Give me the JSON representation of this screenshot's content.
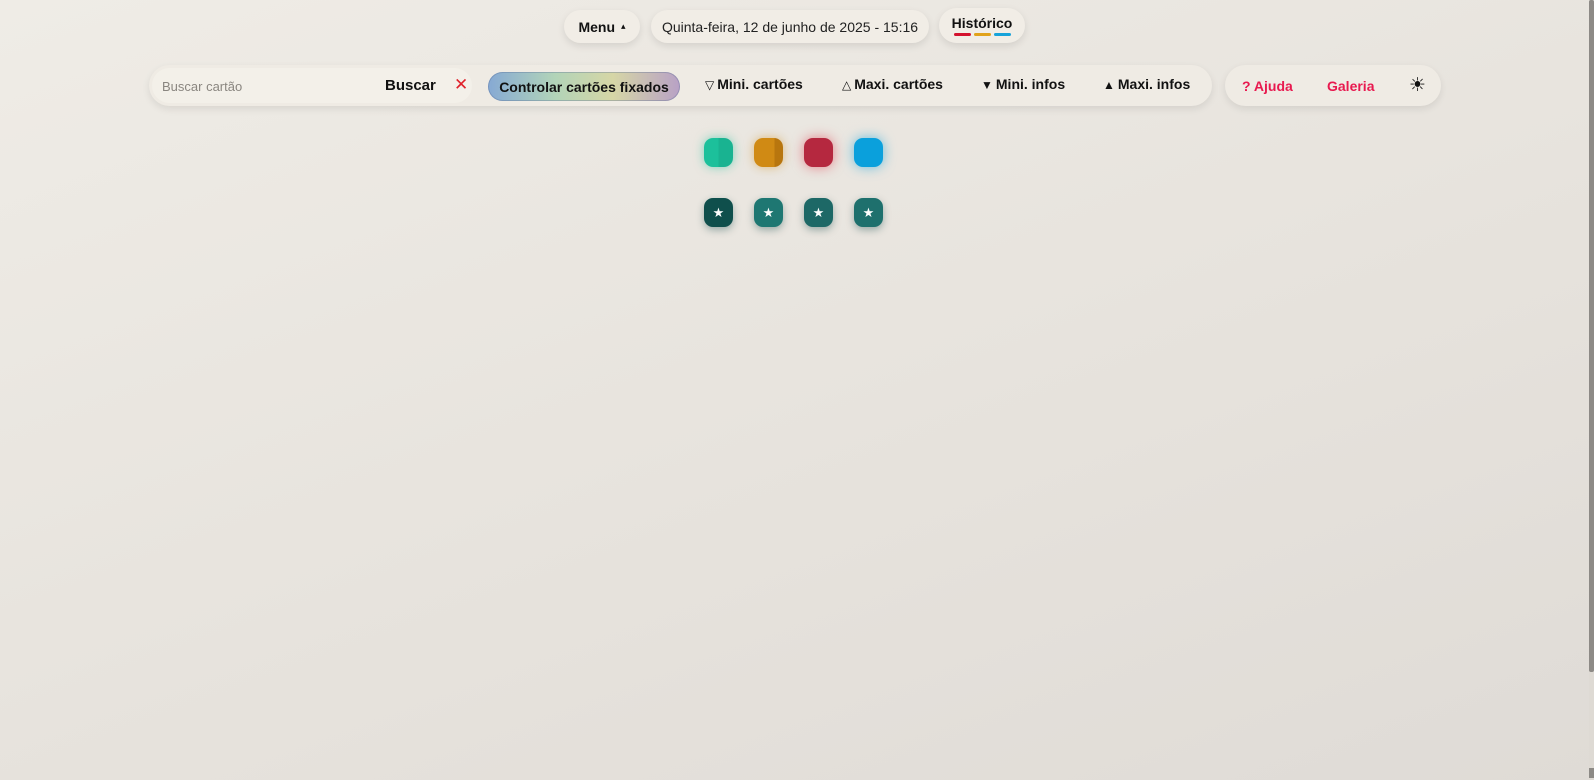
{
  "header": {
    "menu_label": "Menu",
    "menu_caret": "▴",
    "date_text": "Quinta-feira, 12 de junho de 2025 - 15:16",
    "history_label": "Histórico",
    "history_bar_colors": [
      "#d4122e",
      "#e1a21a",
      "#17a3da"
    ]
  },
  "toolbar": {
    "search_placeholder": "Buscar cartão",
    "search_value": "",
    "search_label": "Buscar",
    "clear_symbol": "✕",
    "fixed_cards_label": "Controlar cartões fixados",
    "mini_cards_symbol": "▽",
    "mini_cards_label": "Mini. cartões",
    "maxi_cards_symbol": "△",
    "maxi_cards_label": "Maxi. cartões",
    "mini_infos_symbol": "▼",
    "mini_infos_label": "Mini. infos",
    "maxi_infos_symbol": "▲",
    "maxi_infos_label": "Maxi. infos"
  },
  "right_actions": {
    "help_label": "? Ajuda",
    "gallery_label": "Galeria",
    "theme_icon": "sun-icon",
    "theme_glyph": "☀"
  },
  "color_squares": [
    {
      "name": "green",
      "color": "#1cc09b"
    },
    {
      "name": "orange",
      "color": "#d08a14"
    },
    {
      "name": "red",
      "color": "#b5283f"
    },
    {
      "name": "blue",
      "color": "#0aa0dc"
    }
  ],
  "pinned_cards": [
    {
      "glyph": "★",
      "color": "#0f4f4c"
    },
    {
      "glyph": "★",
      "color": "#1e7772"
    },
    {
      "glyph": "★",
      "color": "#1d6866"
    },
    {
      "glyph": "★",
      "color": "#1e706d"
    }
  ]
}
